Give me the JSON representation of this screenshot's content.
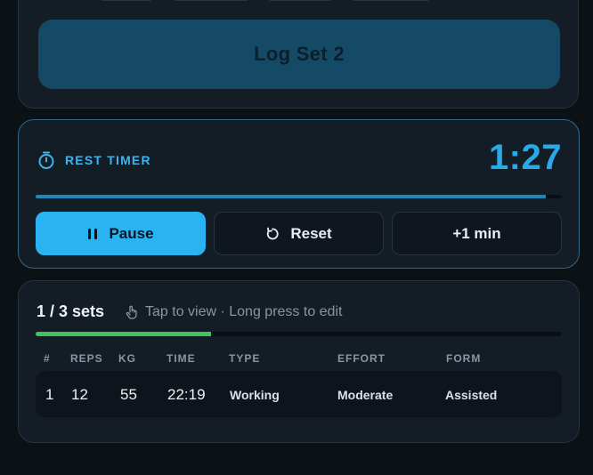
{
  "log": {
    "button_label": "Log Set 2"
  },
  "timer": {
    "label": "REST TIMER",
    "value": "1:27",
    "progress": 0.97,
    "buttons": {
      "pause": "Pause",
      "reset": "Reset",
      "add": "+1 min"
    }
  },
  "sets": {
    "summary": "1 / 3 sets",
    "hint": "Tap to view · Long press to edit",
    "progress": 0.333,
    "columns": [
      "#",
      "REPS",
      "KG",
      "TIME",
      "TYPE",
      "EFFORT",
      "FORM"
    ],
    "rows": [
      {
        "num": "1",
        "reps": "12",
        "kg": "55",
        "time": "22:19",
        "type": "Working",
        "effort": "Moderate",
        "form": "Assisted"
      }
    ]
  },
  "icons": {
    "timer": "stopwatch-icon",
    "pause": "pause-icon",
    "reset": "reset-icon",
    "hint": "hand-tap-icon"
  },
  "colors": {
    "accent": "#2ab3f3",
    "timer_text": "#2aa9e8",
    "progress_green": "#3fc35a"
  }
}
